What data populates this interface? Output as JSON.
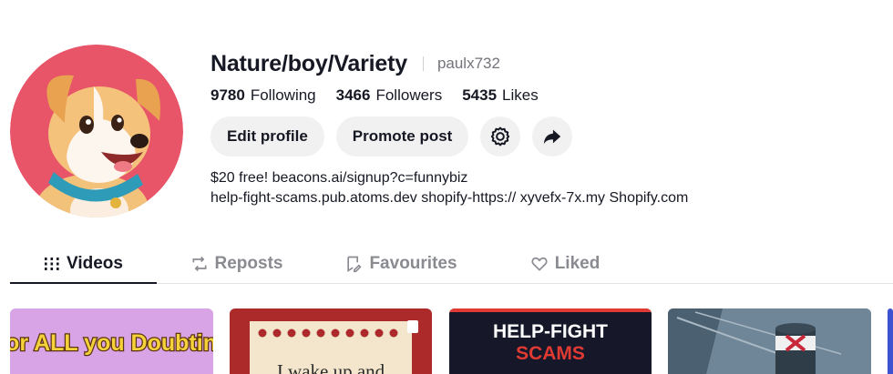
{
  "profile": {
    "display_name": "Nature/boy/Variety",
    "username": "paulx732",
    "avatar_icon": "cartoon-dog-avatar"
  },
  "stats": [
    {
      "value": "9780",
      "label": "Following"
    },
    {
      "value": "3466",
      "label": "Followers"
    },
    {
      "value": "5435",
      "label": "Likes"
    }
  ],
  "actions": {
    "edit_profile": "Edit profile",
    "promote_post": "Promote post",
    "settings_icon": "gear-icon",
    "share_icon": "share-arrow-icon"
  },
  "bio": {
    "line1": "$20 free! beacons.ai/signup?c=funnybiz",
    "line2": "help-fight-scams.pub.atoms.dev shopify-https:// xyvefx-7x.my Shopify.com"
  },
  "tabs": [
    {
      "label": "Videos",
      "icon": "grid-icon",
      "active": true
    },
    {
      "label": "Reposts",
      "icon": "repost-icon",
      "active": false
    },
    {
      "label": "Favourites",
      "icon": "bookmark-icon",
      "active": false
    },
    {
      "label": "Liked",
      "icon": "heart-icon",
      "active": false
    }
  ],
  "thumbnails": [
    {
      "text": "For ALL you Doubting"
    },
    {
      "text": "I wake up and"
    },
    {
      "text_line1": "HELP-FIGHT",
      "text_line2": "SCAMS"
    },
    {
      "text": ""
    }
  ],
  "colors": {
    "text_primary": "#161823",
    "text_secondary": "#73747b",
    "button_bg": "#f1f1f2",
    "scams_red": "#e03a32",
    "avatar_bg": "#e85468"
  }
}
